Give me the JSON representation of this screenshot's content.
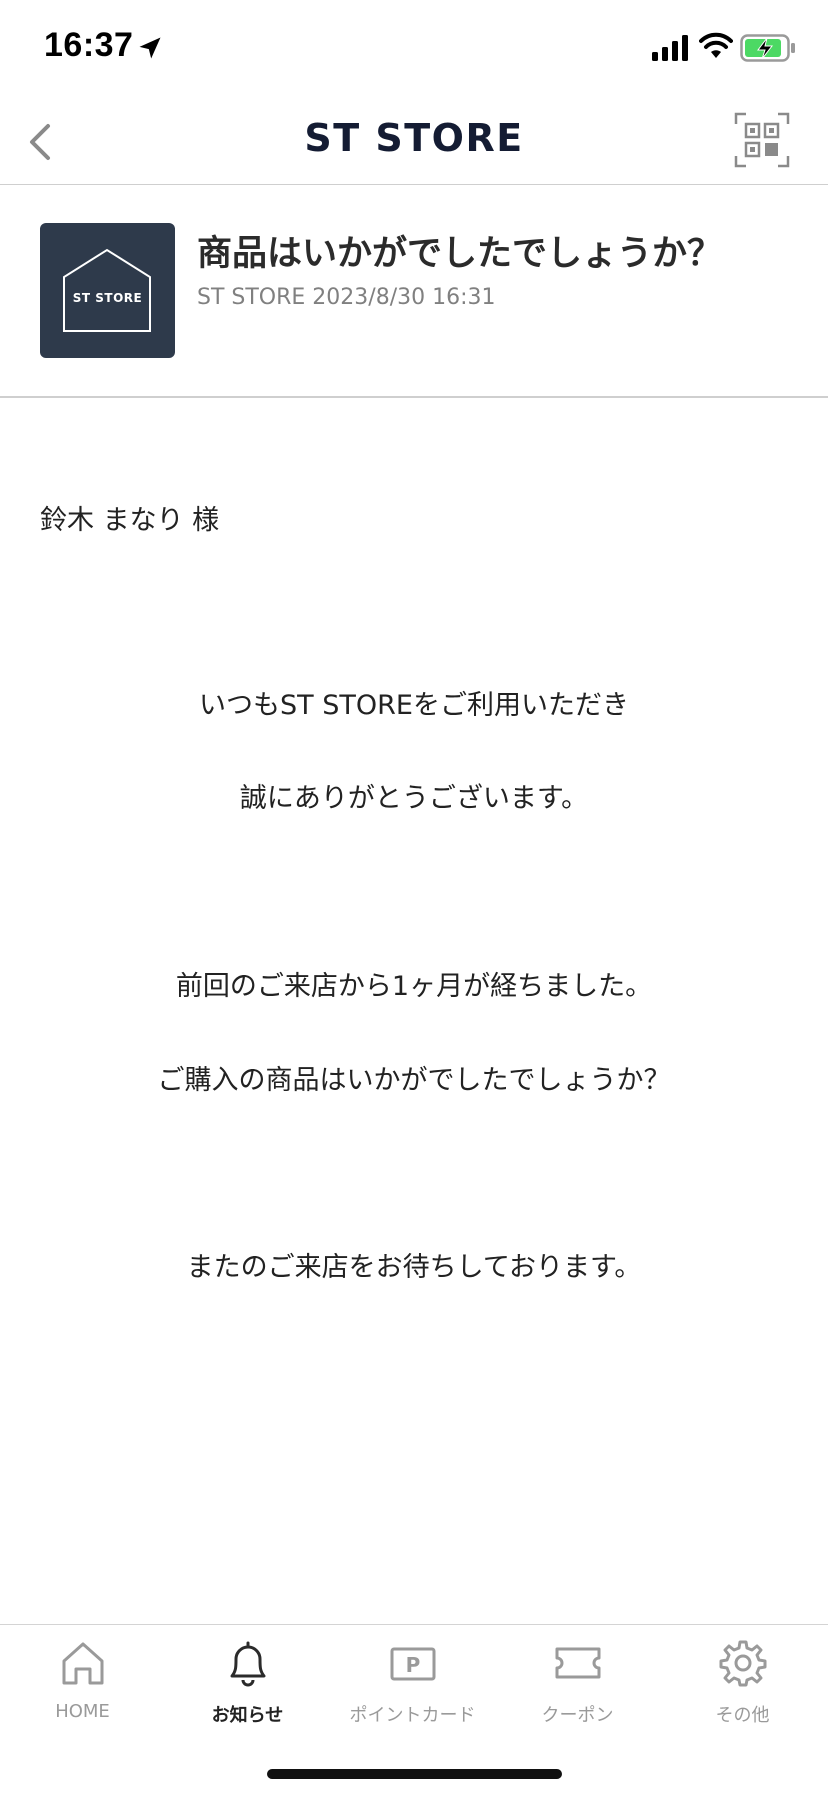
{
  "status_bar": {
    "time": "16:37"
  },
  "nav": {
    "title": "ST STORE"
  },
  "message": {
    "logo_text": "ST STORE",
    "title": "商品はいかがでしたでしょうか？",
    "meta": "ST STORE 2023/8/30 16:31",
    "recipient": "鈴木 まなり 様",
    "lines": [
      "いつもST STOREをご利用いただき",
      "誠にありがとうございます。",
      "前回のご来店から1ヶ月が経ちました。",
      "ご購入の商品はいかがでしたでしょうか？",
      "またのご来店をお待ちしております。"
    ]
  },
  "tabs": [
    {
      "label": "HOME",
      "icon": "home-icon",
      "active": false
    },
    {
      "label": "お知らせ",
      "icon": "bell-icon",
      "active": true
    },
    {
      "label": "ポイントカード",
      "icon": "point-card-icon",
      "active": false
    },
    {
      "label": "クーポン",
      "icon": "coupon-icon",
      "active": false
    },
    {
      "label": "その他",
      "icon": "gear-icon",
      "active": false
    }
  ],
  "colors": {
    "brand_navy": "#141c33",
    "logo_bg": "#2e3a4b",
    "tab_inactive": "#9a9a9a",
    "battery_green": "#4cd964"
  }
}
